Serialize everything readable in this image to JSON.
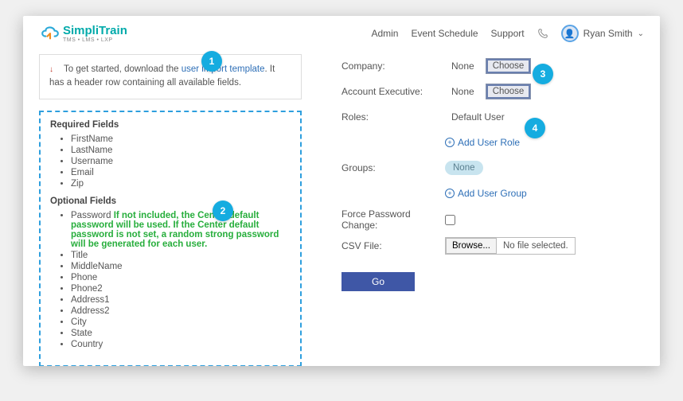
{
  "header": {
    "brand_name": "SimpliTrain",
    "brand_sub": "TMS • LMS • LXP",
    "nav": {
      "admin": "Admin",
      "events": "Event Schedule",
      "support": "Support"
    },
    "user": "Ryan Smith"
  },
  "info": {
    "prefix": "To get started, download the ",
    "link": "user import template",
    "suffix": ". It has a header row containing all available fields."
  },
  "fields": {
    "req_h": "Required Fields",
    "opt_h": "Optional Fields",
    "req": [
      "FirstName",
      "LastName",
      "Username",
      "Email",
      "Zip"
    ],
    "pw_label": "Password ",
    "pw_note": "If not included, the Center default password will be used. If the Center default password is not set, a random strong password will be generated for each user.",
    "opt": [
      "Title",
      "MiddleName",
      "Phone",
      "Phone2",
      "Address1",
      "Address2",
      "City",
      "State",
      "Country"
    ]
  },
  "form": {
    "company_l": "Company:",
    "ae_l": "Account Executive:",
    "roles_l": "Roles:",
    "groups_l": "Groups:",
    "fpc_l": "Force Password Change:",
    "csv_l": "CSV File:",
    "none": "None",
    "choose": "Choose",
    "role_val": "Default User",
    "add_role": "Add User Role",
    "add_group": "Add User Group",
    "browse": "Browse...",
    "nofile": "No file selected.",
    "go": "Go"
  },
  "bubbles": {
    "b1": "1",
    "b2": "2",
    "b3": "3",
    "b4": "4"
  }
}
